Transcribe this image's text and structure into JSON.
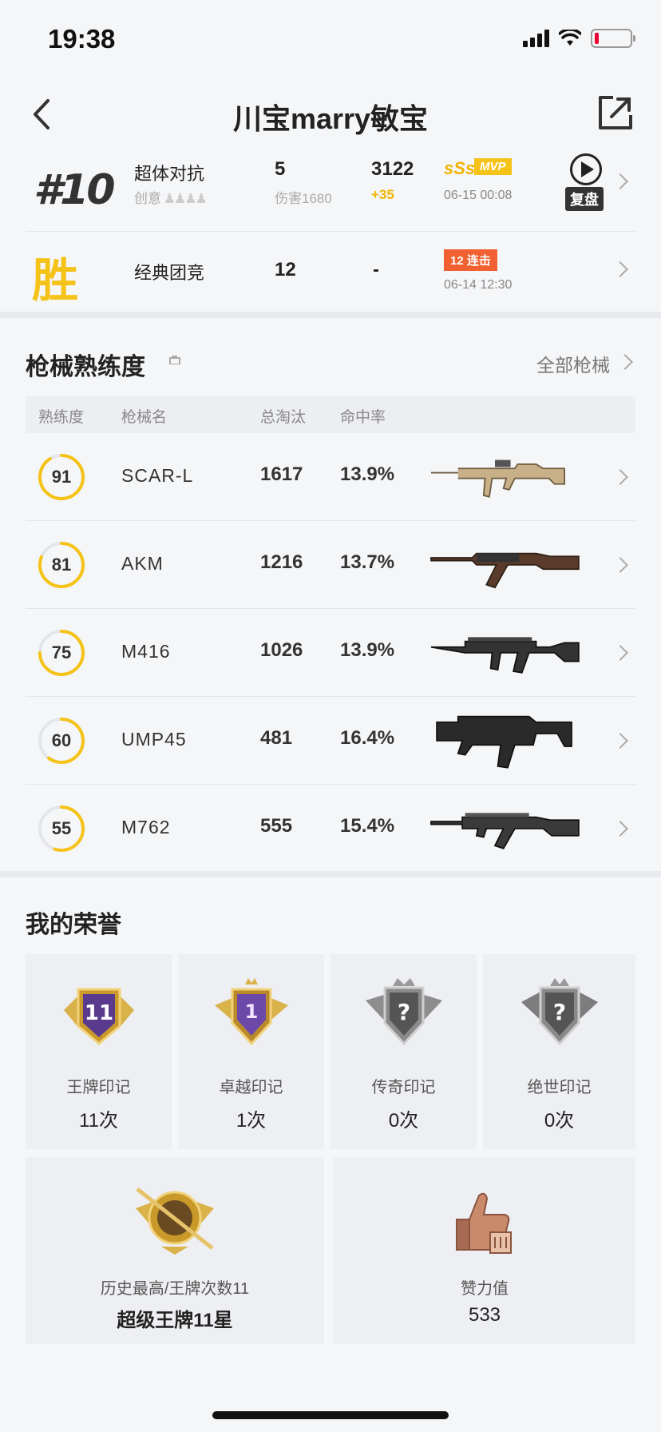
{
  "status": {
    "time": "19:38"
  },
  "header": {
    "title": "川宝marry敏宝"
  },
  "matches": [
    {
      "rank": "#10",
      "mode": "超体对抗",
      "sub": "创意",
      "kills": "5",
      "damage": "伤害1680",
      "score": "3122",
      "delta": "+35",
      "grade": "sSs",
      "mvp": "MVP",
      "date": "06-15 00:08",
      "replay": "复盘"
    },
    {
      "result": "胜",
      "mode": "经典团竞",
      "kills": "12",
      "score": "-",
      "streak": "12 连击",
      "date": "06-14 12:30"
    }
  ],
  "weapons": {
    "title": "枪械熟练度",
    "all_label": "全部枪械",
    "headers": {
      "mastery": "熟练度",
      "name": "枪械名",
      "kills": "总淘汰",
      "accuracy": "命中率"
    },
    "rows": [
      {
        "mastery": 91,
        "name": "SCAR-L",
        "kills": "1617",
        "accuracy": "13.9%"
      },
      {
        "mastery": 81,
        "name": "AKM",
        "kills": "1216",
        "accuracy": "13.7%"
      },
      {
        "mastery": 75,
        "name": "M416",
        "kills": "1026",
        "accuracy": "13.9%"
      },
      {
        "mastery": 60,
        "name": "UMP45",
        "kills": "481",
        "accuracy": "16.4%"
      },
      {
        "mastery": 55,
        "name": "M762",
        "kills": "555",
        "accuracy": "15.4%"
      }
    ]
  },
  "honors": {
    "title": "我的荣誉",
    "cards": [
      {
        "name": "王牌印记",
        "value": "11次",
        "badge_text": "11"
      },
      {
        "name": "卓越印记",
        "value": "1次",
        "badge_text": "1"
      },
      {
        "name": "传奇印记",
        "value": "0次",
        "badge_text": "?"
      },
      {
        "name": "绝世印记",
        "value": "0次",
        "badge_text": "?"
      }
    ],
    "best": {
      "name": "历史最高/王牌次数11",
      "value": "超级王牌11星"
    },
    "likes": {
      "name": "赞力值",
      "value": "533"
    }
  },
  "colors": {
    "accent": "#f5c318",
    "streak": "#f06030"
  }
}
